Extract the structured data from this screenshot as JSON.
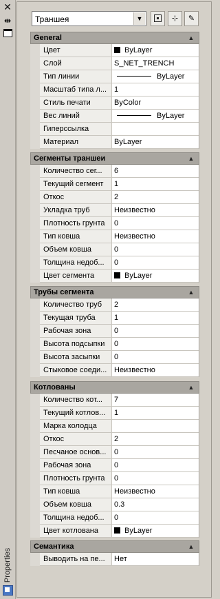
{
  "palette": {
    "title": "Properties"
  },
  "toolbar": {
    "selector_value": "Траншея",
    "btn_toggle_pickadd": "toggle-pickadd",
    "btn_select_objects": "select-objects",
    "btn_quick_select": "quick-select"
  },
  "sections": [
    {
      "title": "General",
      "rows": [
        {
          "label": "Цвет",
          "value": "ByLayer",
          "swatch": true
        },
        {
          "label": "Слой",
          "value": "S_NET_TRENCH"
        },
        {
          "label": "Тип линии",
          "value": "ByLayer",
          "line": true
        },
        {
          "label": "Масштаб типа л...",
          "value": "1"
        },
        {
          "label": "Стиль печати",
          "value": "ByColor"
        },
        {
          "label": "Вес линий",
          "value": "ByLayer",
          "line": true
        },
        {
          "label": "Гиперссылка",
          "value": ""
        },
        {
          "label": "Материал",
          "value": "ByLayer"
        }
      ]
    },
    {
      "title": "Сегменты траншеи",
      "rows": [
        {
          "label": "Количество сег...",
          "value": "6"
        },
        {
          "label": "Текущий сегмент",
          "value": "1"
        },
        {
          "label": "Откос",
          "value": "2"
        },
        {
          "label": "Укладка труб",
          "value": "Неизвестно"
        },
        {
          "label": "Плотность грунта",
          "value": "0"
        },
        {
          "label": "Тип ковша",
          "value": "Неизвестно"
        },
        {
          "label": "Объем ковша",
          "value": "0"
        },
        {
          "label": "Толщина недоб...",
          "value": "0"
        },
        {
          "label": "Цвет сегмента",
          "value": "ByLayer",
          "swatch": true
        }
      ]
    },
    {
      "title": "Трубы сегмента",
      "rows": [
        {
          "label": "Количество труб",
          "value": "2"
        },
        {
          "label": "Текущая труба",
          "value": "1"
        },
        {
          "label": "Рабочая зона",
          "value": "0"
        },
        {
          "label": "Высота подсыпки",
          "value": "0"
        },
        {
          "label": "Высота засыпки",
          "value": "0"
        },
        {
          "label": "Стыковое соеди...",
          "value": "Неизвестно"
        }
      ]
    },
    {
      "title": "Котлованы",
      "rows": [
        {
          "label": "Количество кот...",
          "value": "7"
        },
        {
          "label": "Текущий котлов...",
          "value": "1"
        },
        {
          "label": "Марка колодца",
          "value": ""
        },
        {
          "label": "Откос",
          "value": "2"
        },
        {
          "label": "Песчаное основ...",
          "value": "0"
        },
        {
          "label": "Рабочая зона",
          "value": "0"
        },
        {
          "label": "Плотность грунта",
          "value": "0"
        },
        {
          "label": "Тип ковша",
          "value": "Неизвестно"
        },
        {
          "label": "Объем ковша",
          "value": "0.3"
        },
        {
          "label": "Толщина недоб...",
          "value": "0"
        },
        {
          "label": "Цвет котлована",
          "value": "ByLayer",
          "swatch": true
        }
      ]
    },
    {
      "title": "Семантика",
      "rows": [
        {
          "label": "Выводить на пе...",
          "value": "Нет"
        }
      ]
    }
  ]
}
